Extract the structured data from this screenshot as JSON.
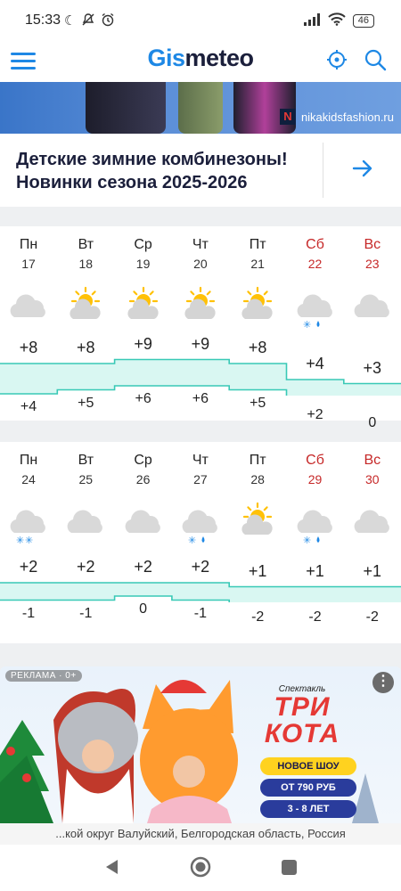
{
  "status_bar": {
    "time": "15:33",
    "left_icons": [
      "moon-icon",
      "mute-icon",
      "alarm-icon"
    ],
    "right_icons": [
      "signal-icon",
      "wifi-icon",
      "battery-icon"
    ],
    "battery": "46"
  },
  "app": {
    "logo_part1": "Gis",
    "logo_part2": "meteo",
    "accent_color": "#1e88e5"
  },
  "banner": {
    "site": "nikakidsfashion.ru",
    "title": "Детские зимние комбинезоны! Новинки сезона 2025-2026"
  },
  "forecast_week1": {
    "days": [
      {
        "name": "Пн",
        "date": "17",
        "icon": "cloud-icon",
        "max": "+8",
        "min": "+4",
        "weekend": false
      },
      {
        "name": "Вт",
        "date": "18",
        "icon": "partly-sunny-icon",
        "max": "+8",
        "min": "+5",
        "weekend": false
      },
      {
        "name": "Ср",
        "date": "19",
        "icon": "partly-sunny-icon",
        "max": "+9",
        "min": "+6",
        "weekend": false
      },
      {
        "name": "Чт",
        "date": "20",
        "icon": "partly-sunny-icon",
        "max": "+9",
        "min": "+6",
        "weekend": false
      },
      {
        "name": "Пт",
        "date": "21",
        "icon": "partly-sunny-icon",
        "max": "+8",
        "min": "+5",
        "weekend": false
      },
      {
        "name": "Сб",
        "date": "22",
        "icon": "cloud-snow-rain-icon",
        "max": "+4",
        "min": "+2",
        "weekend": true
      },
      {
        "name": "Вс",
        "date": "23",
        "icon": "cloud-icon",
        "max": "+3",
        "min": "0",
        "weekend": true
      }
    ]
  },
  "forecast_week2": {
    "days": [
      {
        "name": "Пн",
        "date": "24",
        "icon": "cloud-snow-icon",
        "max": "+2",
        "min": "-1",
        "weekend": false
      },
      {
        "name": "Вт",
        "date": "25",
        "icon": "cloud-icon",
        "max": "+2",
        "min": "-1",
        "weekend": false
      },
      {
        "name": "Ср",
        "date": "26",
        "icon": "cloud-icon",
        "max": "+2",
        "min": "0",
        "weekend": false
      },
      {
        "name": "Чт",
        "date": "27",
        "icon": "cloud-snow-rain-icon",
        "max": "+2",
        "min": "-1",
        "weekend": false
      },
      {
        "name": "Пт",
        "date": "28",
        "icon": "partly-sunny-icon",
        "max": "+1",
        "min": "-2",
        "weekend": false
      },
      {
        "name": "Сб",
        "date": "29",
        "icon": "cloud-snow-rain-icon",
        "max": "+1",
        "min": "-2",
        "weekend": true
      },
      {
        "name": "Вс",
        "date": "30",
        "icon": "cloud-icon",
        "max": "+1",
        "min": "-2",
        "weekend": true
      }
    ]
  },
  "ad": {
    "label": "РЕКЛАМА · 0+",
    "show_small": "Спектакль",
    "show_title": "ТРИ КОТА",
    "promo1": "НОВОЕ ШОУ",
    "promo2": "ОТ 790 РУБ",
    "promo3": "3 - 8 ЛЕТ"
  },
  "location": "...кой округ Валуйский, Белгородская область, Россия",
  "colors": {
    "weekend": "#c62828",
    "chart_fill": "#d9f7f2",
    "chart_line": "#39c9b6"
  }
}
